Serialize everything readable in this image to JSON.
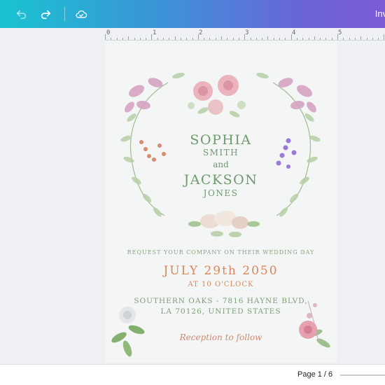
{
  "toolbar": {
    "undo_icon": "undo-icon",
    "redo_icon": "redo-icon",
    "save_status_icon": "cloud-check-icon",
    "invite_label": "Invi"
  },
  "ruler": {
    "marks": [
      "0",
      "1",
      "2",
      "3",
      "4",
      "5"
    ]
  },
  "invitation": {
    "first_name_1": "SOPHIA",
    "last_name_1": "SMITH",
    "conjunction": "and",
    "first_name_2": "JACKSON",
    "last_name_2": "JONES",
    "request": "REQUEST YOUR COMPANY ON THEIR WEDDING DAY",
    "date": "JULY 29th 2050",
    "time": "AT 10 O'CLOCK",
    "address_line_1": "SOUTHERN OAKS - 7816 HAYNE BLVD,",
    "address_line_2": "LA 70126, UNITED STATES",
    "reception": "Reception to follow"
  },
  "footer": {
    "page_indicator": "Page 1 / 6"
  },
  "colors": {
    "toolbar_gradient_start": "#19c3d1",
    "toolbar_gradient_end": "#7b5bd6",
    "names_green": "#6e9a6c",
    "date_orange": "#d9865a",
    "reception_rose": "#c98a74",
    "page_bg": "#f4f5f5"
  }
}
